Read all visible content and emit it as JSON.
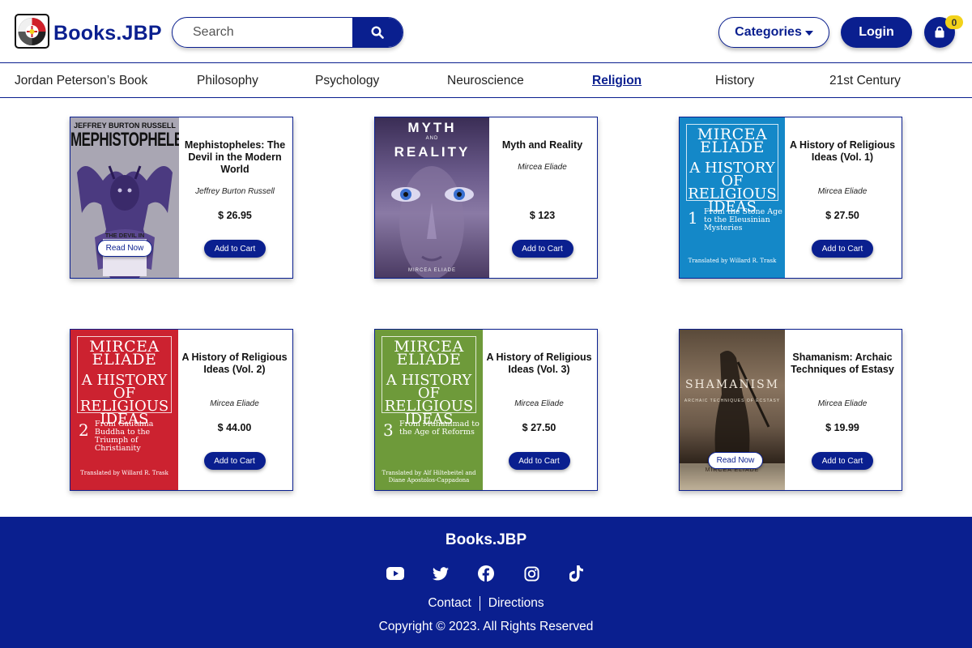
{
  "header": {
    "brand": "Books.JBP",
    "search_placeholder": "Search",
    "categories_label": "Categories",
    "login_label": "Login",
    "cart_count": "0"
  },
  "nav": {
    "items": [
      {
        "label": "Jordan Peterson’s Book"
      },
      {
        "label": "Philosophy"
      },
      {
        "label": "Psychology"
      },
      {
        "label": "Neuroscience"
      },
      {
        "label": "Religion",
        "active": true
      },
      {
        "label": "History"
      },
      {
        "label": "21st Century"
      }
    ]
  },
  "books": [
    {
      "title": "Mephistopheles: The Devil in the Modern World",
      "author": "Jeffrey Burton Russell",
      "price": "$ 26.95",
      "cta": "Add to Cart",
      "read_now": "Read Now",
      "cover": {
        "author": "JEFFREY BURTON RUSSELL",
        "title": "MEPHISTOPHELES",
        "sub": "THE DEVIL IN THE MODERN WORLD"
      }
    },
    {
      "title": "Myth and Reality",
      "author": "Mircea Eliade",
      "price": "$ 123",
      "cta": "Add to Cart",
      "cover": {
        "line1": "MYTH",
        "and": "AND",
        "line2": "REALITY",
        "author": "MIRCEA ELIADE"
      }
    },
    {
      "title": "A History of Religious Ideas (Vol. 1)",
      "author": "Mircea Eliade",
      "price": "$ 27.50",
      "cta": "Add to Cart",
      "cover": {
        "name": "MIRCEA ELIADE",
        "title": "A HISTORY OF RELIGIOUS IDEAS",
        "vol": "1",
        "sub": "From the Stone Age to the Eleusinian Mysteries",
        "trans": "Translated by Willard R. Trask"
      }
    },
    {
      "title": "A History of Religious Ideas (Vol. 2)",
      "author": "Mircea Eliade",
      "price": "$ 44.00",
      "cta": "Add to Cart",
      "cover": {
        "name": "MIRCEA ELIADE",
        "title": "A HISTORY OF RELIGIOUS IDEAS",
        "vol": "2",
        "sub": "From Gautama Buddha to the Triumph of Christianity",
        "trans": "Translated by Willard R. Trask"
      }
    },
    {
      "title": "A History of Religious Ideas (Vol. 3)",
      "author": "Mircea Eliade",
      "price": "$ 27.50",
      "cta": "Add to Cart",
      "cover": {
        "name": "MIRCEA ELIADE",
        "title": "A HISTORY OF RELIGIOUS IDEAS",
        "vol": "3",
        "sub": "From Muhammad to the Age of Reforms",
        "trans": "Translated by Alf Hiltebeitel and Diane Apostolos-Cappadona"
      }
    },
    {
      "title": "Shamanism: Archaic Techniques of Estasy",
      "author": "Mircea Eliade",
      "price": "$ 19.99",
      "cta": "Add to Cart",
      "read_now": "Read Now",
      "cover": {
        "title": "SHAMANISM",
        "sub": "ARCHAIC TECHNIQUES OF ECSTASY",
        "author": "MIRCEA ELIADE"
      }
    }
  ],
  "footer": {
    "brand": "Books.JBP",
    "socials": [
      "youtube-icon",
      "twitter-icon",
      "facebook-icon",
      "instagram-icon",
      "tiktok-icon"
    ],
    "contact": "Contact",
    "directions": "Directions",
    "copyright": "Copyright © 2023. All Rights Reserved"
  },
  "colors": {
    "primary": "#0a1f8f",
    "badge": "#f2d21a",
    "blue_cover": "#1488c8",
    "red_cover": "#cc2230",
    "green_cover": "#6e9a3a"
  }
}
